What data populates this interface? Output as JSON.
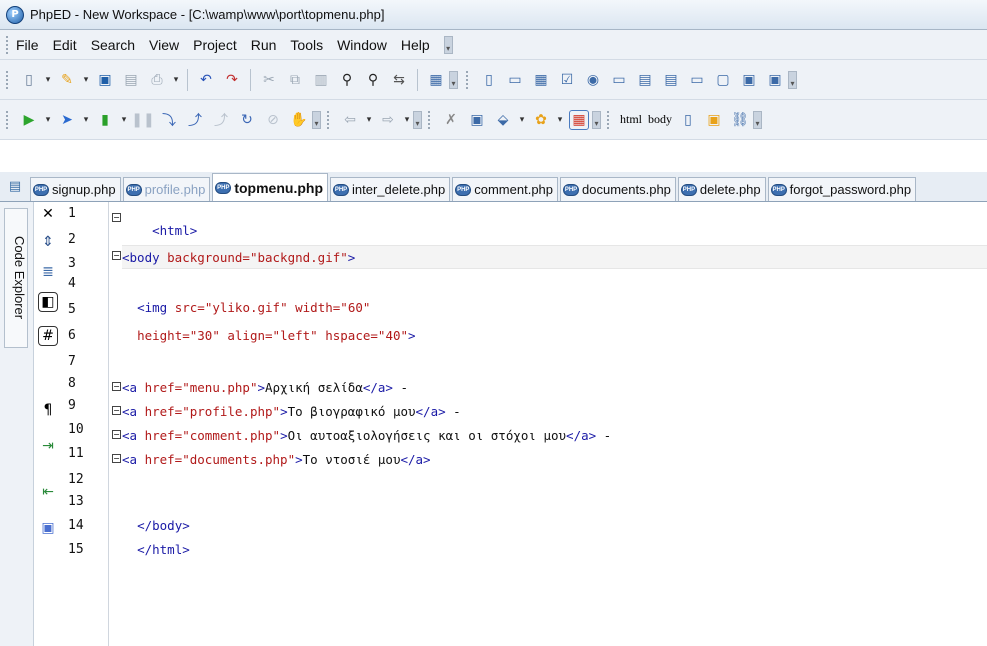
{
  "window": {
    "title": "PhpED - New Workspace - [C:\\wamp\\www\\port\\topmenu.php]"
  },
  "menu": [
    "File",
    "Edit",
    "Search",
    "View",
    "Project",
    "Run",
    "Tools",
    "Window",
    "Help"
  ],
  "toolbar2": {
    "html_label": "html",
    "body_label": "body"
  },
  "side_panel": {
    "label": "Code Explorer"
  },
  "tabs": [
    {
      "label": "signup.php"
    },
    {
      "label": "profile.php"
    },
    {
      "label": "topmenu.php"
    },
    {
      "label": "inter_delete.php"
    },
    {
      "label": "comment.php"
    },
    {
      "label": "documents.php"
    },
    {
      "label": "delete.php"
    },
    {
      "label": "forgot_password.php"
    }
  ],
  "line_numbers": [
    "1",
    "2",
    "3",
    "4",
    "5",
    "6",
    "7",
    "8",
    "9",
    "10",
    "11",
    "12",
    "13",
    "14",
    "15"
  ],
  "code": {
    "l1": {
      "a": "<html>"
    },
    "l2": {
      "a": "<body ",
      "b": "background=",
      "c": "\"backgnd.gif\"",
      "d": ">"
    },
    "l4": {
      "a": "<img ",
      "b": "src=",
      "c": "\"yliko.gif\"",
      "d": " width=",
      "e": "\"60\""
    },
    "l5": {
      "a": "height=",
      "b": "\"30\"",
      "c": " align=",
      "d": "\"left\"",
      "e": " hspace=",
      "f": "\"40\"",
      "g": ">"
    },
    "l7": {
      "a": "<a ",
      "b": "href=",
      "c": "\"menu.php\"",
      "d": ">",
      "e": "Αρχική σελίδα",
      "f": "</a>",
      "g": " -"
    },
    "l8": {
      "a": "<a ",
      "b": "href=",
      "c": "\"profile.php\"",
      "d": ">",
      "e": "Το βιογραφικό μου",
      "f": "</a>",
      "g": " -"
    },
    "l9": {
      "a": "<a ",
      "b": "href=",
      "c": "\"comment.php\"",
      "d": ">",
      "e": "Οι αυτοαξιολογήσεις και οι στόχοι μου",
      "f": "</a>",
      "g": " -"
    },
    "l10": {
      "a": "<a ",
      "b": "href=",
      "c": "\"documents.php\"",
      "d": ">",
      "e": "Το ντοσιέ μου",
      "f": "</a>"
    },
    "l12": {
      "a": "</body>"
    },
    "l13": {
      "a": "</html>"
    }
  }
}
